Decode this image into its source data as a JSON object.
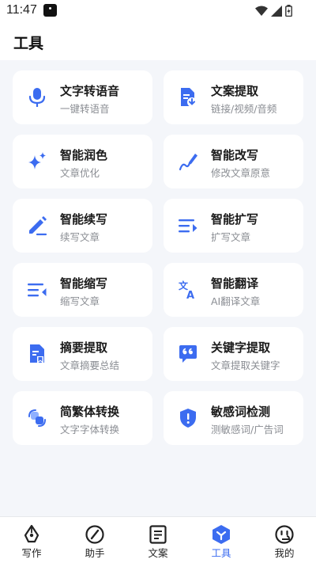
{
  "status_bar": {
    "time": "11:47"
  },
  "page": {
    "title": "工具"
  },
  "colors": {
    "accent": "#3c6cf0",
    "text": "#1a1a1a",
    "subtext": "#8a8d93"
  },
  "tools": [
    {
      "title": "文字转语音",
      "subtitle": "一键转语音",
      "icon": "microphone-icon"
    },
    {
      "title": "文案提取",
      "subtitle": "链接/视频/音频",
      "icon": "document-extract-icon"
    },
    {
      "title": "智能润色",
      "subtitle": "文章优化",
      "icon": "sparkle-icon"
    },
    {
      "title": "智能改写",
      "subtitle": "修改文章原意",
      "icon": "pen-curve-icon"
    },
    {
      "title": "智能续写",
      "subtitle": "续写文章",
      "icon": "edit-pen-icon"
    },
    {
      "title": "智能扩写",
      "subtitle": "扩写文章",
      "icon": "list-expand-icon"
    },
    {
      "title": "智能缩写",
      "subtitle": "缩写文章",
      "icon": "list-shrink-icon"
    },
    {
      "title": "智能翻译",
      "subtitle": "AI翻译文章",
      "icon": "translate-icon"
    },
    {
      "title": "摘要提取",
      "subtitle": "文章摘要总结",
      "icon": "summary-doc-icon"
    },
    {
      "title": "关键字提取",
      "subtitle": "文章提取关键字",
      "icon": "quote-bubble-icon"
    },
    {
      "title": "简繁体转换",
      "subtitle": "文字字体转换",
      "icon": "convert-icon"
    },
    {
      "title": "敏感词检测",
      "subtitle": "测敏感词/广告词",
      "icon": "shield-alert-icon"
    }
  ],
  "tabbar": [
    {
      "label": "写作",
      "icon": "pen-nib-icon"
    },
    {
      "label": "助手",
      "icon": "compass-icon"
    },
    {
      "label": "文案",
      "icon": "document-icon"
    },
    {
      "label": "工具",
      "icon": "tools-cube-icon",
      "active": true
    },
    {
      "label": "我的",
      "icon": "profile-face-icon"
    }
  ]
}
